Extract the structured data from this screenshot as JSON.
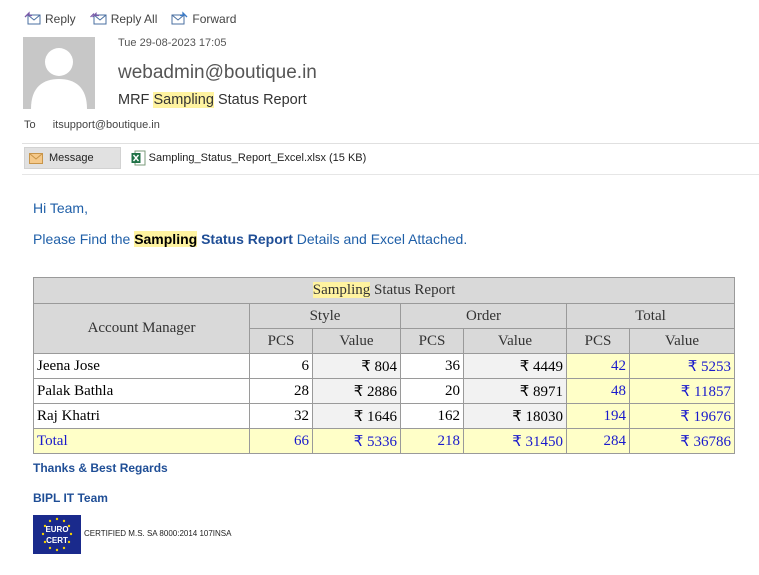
{
  "toolbar": {
    "reply": "Reply",
    "reply_all": "Reply All",
    "forward": "Forward"
  },
  "header": {
    "date": "Tue 29-08-2023 17:05",
    "sender": "webadmin@boutique.in",
    "subject_prefix": "MRF",
    "subject_highlight": "Sampling",
    "subject_suffix": "Status Report",
    "to_label": "To",
    "to_address": "itsupport@boutique.in"
  },
  "attachments": {
    "message_tab": "Message",
    "file": "Sampling_Status_Report_Excel.xlsx (15 KB)"
  },
  "body": {
    "greeting": "Hi Team,",
    "line_pre": "Please Find the",
    "line_highlight": "Sampling",
    "line_bold": "Status Report",
    "line_post": "Details and Excel Attached."
  },
  "table": {
    "title_highlight": "Sampling",
    "title_rest": "Status Report",
    "col_account": "Account Manager",
    "group_style": "Style",
    "group_order": "Order",
    "group_total": "Total",
    "sub_pcs": "PCS",
    "sub_value": "Value",
    "rows": [
      {
        "name": "Jeena Jose",
        "style_pcs": "6",
        "style_value": "₹ 804",
        "order_pcs": "36",
        "order_value": "₹ 4449",
        "total_pcs": "42",
        "total_value": "₹ 5253"
      },
      {
        "name": "Palak Bathla",
        "style_pcs": "28",
        "style_value": "₹ 2886",
        "order_pcs": "20",
        "order_value": "₹ 8971",
        "total_pcs": "48",
        "total_value": "₹ 11857"
      },
      {
        "name": "Raj Khatri",
        "style_pcs": "32",
        "style_value": "₹ 1646",
        "order_pcs": "162",
        "order_value": "₹ 18030",
        "total_pcs": "194",
        "total_value": "₹ 19676"
      }
    ],
    "total_row": {
      "name": "Total",
      "style_pcs": "66",
      "style_value": "₹ 5336",
      "order_pcs": "218",
      "order_value": "₹ 31450",
      "total_pcs": "284",
      "total_value": "₹ 36786"
    }
  },
  "signature": {
    "thanks": "Thanks & Best Regards",
    "team": "BIPL IT Team",
    "logo_top": "EURO",
    "logo_bottom": "CERT",
    "cert_text": "CERTIFIED M.S. SA 8000:2014 107INSA"
  },
  "colors": {
    "link_blue": "#1f5fa8",
    "highlight": "#fff3a0",
    "total_fill": "#ffffc8",
    "total_text": "#1a1acc"
  },
  "icons": [
    "reply-icon",
    "reply-all-icon",
    "forward-icon",
    "envelope-icon",
    "excel-file-icon",
    "eurocert-logo"
  ]
}
